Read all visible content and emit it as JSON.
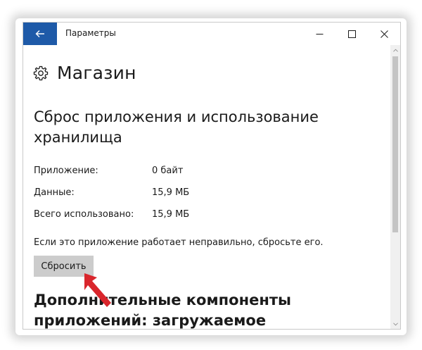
{
  "window": {
    "title": "Параметры"
  },
  "page": {
    "title": "Магазин",
    "icon": "gear-icon"
  },
  "storage_section": {
    "title": "Сброс приложения и использование хранилища",
    "rows": [
      {
        "label": "Приложение:",
        "value": "0 байт"
      },
      {
        "label": "Данные:",
        "value": "15,9 МБ"
      },
      {
        "label": "Всего использовано:",
        "value": "15,9 МБ"
      }
    ],
    "hint": "Если это приложение работает неправильно, сбросьте его.",
    "reset_label": "Сбросить"
  },
  "addons_section": {
    "title": "Дополнительные компоненты приложений: загружаемое содержимое"
  },
  "colors": {
    "back_button": "#1e5aa8",
    "reset_button": "#cccccc",
    "annotation_arrow": "#d9262c"
  }
}
